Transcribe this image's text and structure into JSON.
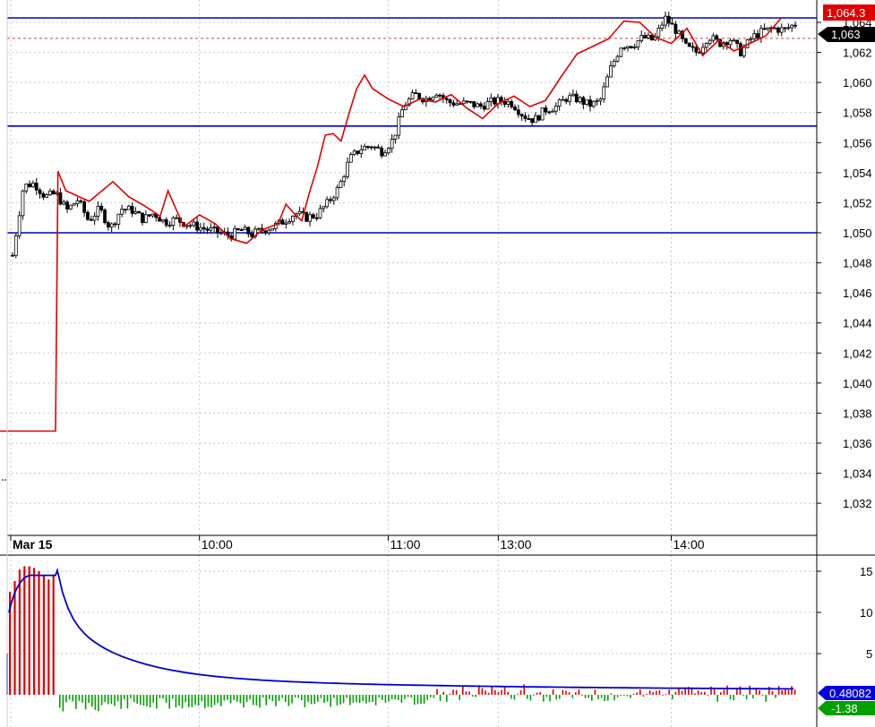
{
  "chart_data": [
    {
      "type": "candlestick",
      "ylim": [
        1030,
        1065
      ],
      "y_ticks": [
        "1,032",
        "1,034",
        "1,036",
        "1,038",
        "1,040",
        "1,042",
        "1,044",
        "1,046",
        "1,048",
        "1,050",
        "1,052",
        "1,054",
        "1,056",
        "1,058",
        "1,060",
        "1,062",
        "1,064"
      ],
      "x_ticks": [
        "Mar 15",
        "10:00",
        "11:00",
        "13:00",
        "14:00"
      ],
      "x_tick_pos": [
        0.0,
        0.24,
        0.48,
        0.62,
        0.84
      ],
      "current_price_label": "1,063",
      "current_price": 1063,
      "resistance_label": "1,064.3",
      "horizontal_lines": [
        1064.3,
        1057.1,
        1050.0
      ],
      "candles_close": [
        1048.5,
        1053.1,
        1053.3,
        1052.4,
        1052.6,
        1051.5,
        1052.2,
        1050.8,
        1051.6,
        1050.3,
        1051.6,
        1051.5,
        1050.9,
        1051.3,
        1050.7,
        1050.9,
        1050.6,
        1050.4,
        1050.2,
        1050.0,
        1049.8,
        1050.2,
        1049.9,
        1050.2,
        1050.4,
        1050.8,
        1051.3,
        1051.0,
        1051.2,
        1052.0,
        1053.0,
        1054.9,
        1055.6,
        1055.8,
        1055.4,
        1056.2,
        1058.5,
        1059.2,
        1058.9,
        1059.4,
        1058.7,
        1058.6,
        1058.6,
        1058.4,
        1058.7,
        1058.8,
        1058.6,
        1057.8,
        1057.5,
        1058.2,
        1058.4,
        1059.0,
        1058.9,
        1058.5,
        1058.7,
        1060.9,
        1062.5,
        1062.5,
        1063.0,
        1062.8,
        1064.3,
        1063.5,
        1062.3,
        1062.0,
        1063.1,
        1062.6,
        1062.9,
        1062.0,
        1063.0,
        1063.4,
        1063.6,
        1063.5,
        1063.9
      ],
      "ma_series": [
        1036.8,
        1054.1,
        1052.8,
        1052.1,
        1053.4,
        1052.4,
        1051.8,
        1051.1,
        1052.8,
        1050.4,
        1051.2,
        1050.6,
        1049.6,
        1049.3,
        1050.2,
        1050.6,
        1051.9,
        1051.3,
        1050.8,
        1052.7,
        1054.4,
        1056.5,
        1056.6,
        1056.1,
        1057.9,
        1059.6,
        1060.5,
        1059.6,
        1058.9,
        1058.4,
        1058.9,
        1058.7,
        1059.2,
        1058.3,
        1057.6,
        1058.6,
        1059.1,
        1058.4,
        1058.8,
        1060.4,
        1061.9,
        1062.4,
        1062.9,
        1064.1,
        1064.0,
        1063.0,
        1062.6,
        1063.6,
        1061.8,
        1062.8,
        1062.1,
        1062.6,
        1063.1,
        1064.3
      ],
      "ma_times": [
        0,
        0.06,
        0.07,
        0.1,
        0.13,
        0.15,
        0.17,
        0.19,
        0.2,
        0.22,
        0.24,
        0.26,
        0.28,
        0.3,
        0.32,
        0.34,
        0.35,
        0.36,
        0.37,
        0.38,
        0.39,
        0.4,
        0.41,
        0.42,
        0.43,
        0.44,
        0.45,
        0.46,
        0.48,
        0.5,
        0.52,
        0.54,
        0.56,
        0.58,
        0.6,
        0.62,
        0.64,
        0.66,
        0.68,
        0.7,
        0.72,
        0.74,
        0.76,
        0.78,
        0.8,
        0.82,
        0.84,
        0.86,
        0.88,
        0.9,
        0.92,
        0.94,
        0.96,
        0.98
      ]
    },
    {
      "type": "bar",
      "ylim": [
        -2,
        17
      ],
      "y_ticks": [
        "5",
        "10",
        "15"
      ],
      "y_tick_vals": [
        5,
        10,
        15
      ],
      "last_value_label": "0.48082",
      "last_value": 0.48082,
      "last_bar_label": "-1.38",
      "last_bar": -1.38,
      "early_bars": [
        12.5,
        13.8,
        15.2,
        15.6,
        15.6,
        15.4,
        15.0,
        14.5,
        14.0,
        14.6
      ],
      "line_peak": 14.5,
      "line_end": 0.48
    }
  ]
}
